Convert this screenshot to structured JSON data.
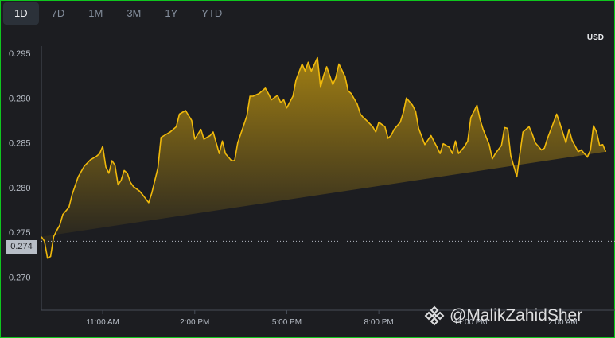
{
  "tabs": [
    {
      "label": "1D",
      "active": true
    },
    {
      "label": "7D",
      "active": false
    },
    {
      "label": "1M",
      "active": false
    },
    {
      "label": "3M",
      "active": false
    },
    {
      "label": "1Y",
      "active": false
    },
    {
      "label": "YTD",
      "active": false
    }
  ],
  "currency": "USD",
  "watermark": "@MalikZahidSher",
  "colors": {
    "background": "#1c1d21",
    "line": "#f0b90b",
    "frame": "#0fc61e",
    "active_tab": "#2b3139"
  },
  "chart_data": {
    "type": "area",
    "ylim": [
      0.2663,
      0.2958
    ],
    "yticks": [
      {
        "value": 0.295,
        "label": "0.295"
      },
      {
        "value": 0.29,
        "label": "0.290"
      },
      {
        "value": 0.285,
        "label": "0.285"
      },
      {
        "value": 0.28,
        "label": "0.280"
      },
      {
        "value": 0.275,
        "label": "0.275"
      },
      {
        "value": 0.27,
        "label": "0.270"
      }
    ],
    "xlim": [
      9.0,
      27.7
    ],
    "xticks": [
      {
        "value": 11,
        "label": "11:00 AM"
      },
      {
        "value": 14,
        "label": "2:00 PM"
      },
      {
        "value": 17,
        "label": "5:00 PM"
      },
      {
        "value": 20,
        "label": "8:00 PM"
      },
      {
        "value": 23,
        "label": "11:00 PM"
      },
      {
        "value": 26,
        "label": "2:00 AM"
      }
    ],
    "current_price": {
      "value": 0.274,
      "label": "0.274"
    },
    "x": [
      9.0,
      9.1,
      9.2,
      9.3,
      9.4,
      9.5,
      9.6,
      9.7,
      9.9,
      10.0,
      10.2,
      10.3,
      10.4,
      10.6,
      10.8,
      10.9,
      11.0,
      11.1,
      11.2,
      11.3,
      11.4,
      11.5,
      11.6,
      11.7,
      11.8,
      11.9,
      12.0,
      12.2,
      12.3,
      12.5,
      12.6,
      12.8,
      12.9,
      13.0,
      13.2,
      13.4,
      13.5,
      13.7,
      13.9,
      14.0,
      14.2,
      14.3,
      14.5,
      14.6,
      14.8,
      14.9,
      15.0,
      15.2,
      15.3,
      15.4,
      15.6,
      15.7,
      15.8,
      15.9,
      16.1,
      16.3,
      16.4,
      16.5,
      16.7,
      16.8,
      16.9,
      17.0,
      17.2,
      17.3,
      17.5,
      17.6,
      17.7,
      17.8,
      18.0,
      18.1,
      18.2,
      18.3,
      18.5,
      18.6,
      18.7,
      18.9,
      19.0,
      19.1,
      19.3,
      19.4,
      19.5,
      19.6,
      19.8,
      19.9,
      20.0,
      20.2,
      20.3,
      20.4,
      20.5,
      20.7,
      20.8,
      20.9,
      21.1,
      21.2,
      21.3,
      21.5,
      21.6,
      21.7,
      21.9,
      22.0,
      22.1,
      22.3,
      22.4,
      22.5,
      22.6,
      22.8,
      22.9,
      23.0,
      23.2,
      23.3,
      23.4,
      23.6,
      23.7,
      23.8,
      24.0,
      24.1,
      24.2,
      24.3,
      24.5,
      24.6,
      24.7,
      24.9,
      25.0,
      25.1,
      25.3,
      25.4,
      25.5,
      25.7,
      25.8,
      25.9,
      26.1,
      26.2,
      26.3,
      26.5,
      26.6,
      26.8,
      26.9,
      27.0,
      27.1,
      27.2,
      27.3,
      27.4,
      27.5,
      27.6
    ],
    "values": [
      0.2745,
      0.274,
      0.2721,
      0.2723,
      0.2745,
      0.2752,
      0.2758,
      0.277,
      0.2778,
      0.2792,
      0.2812,
      0.2818,
      0.2824,
      0.2831,
      0.2835,
      0.2838,
      0.2846,
      0.2823,
      0.2816,
      0.283,
      0.2825,
      0.2803,
      0.2808,
      0.2819,
      0.2816,
      0.2806,
      0.2801,
      0.2796,
      0.2792,
      0.2783,
      0.2794,
      0.2822,
      0.2856,
      0.2858,
      0.2862,
      0.2868,
      0.2882,
      0.2886,
      0.2875,
      0.2854,
      0.2865,
      0.2854,
      0.2858,
      0.2862,
      0.2838,
      0.2852,
      0.2838,
      0.283,
      0.283,
      0.285,
      0.287,
      0.288,
      0.2902,
      0.2902,
      0.2905,
      0.2911,
      0.2905,
      0.2898,
      0.2903,
      0.2895,
      0.2898,
      0.2889,
      0.2902,
      0.292,
      0.2938,
      0.293,
      0.294,
      0.293,
      0.2945,
      0.2912,
      0.2925,
      0.2935,
      0.2915,
      0.2923,
      0.2938,
      0.2924,
      0.2908,
      0.2905,
      0.2893,
      0.2882,
      0.2878,
      0.2875,
      0.2868,
      0.2862,
      0.2873,
      0.2868,
      0.2855,
      0.2858,
      0.2865,
      0.2873,
      0.2884,
      0.29,
      0.2892,
      0.2885,
      0.2866,
      0.2848,
      0.2853,
      0.2858,
      0.2845,
      0.2838,
      0.2849,
      0.2845,
      0.2838,
      0.2852,
      0.2838,
      0.2846,
      0.2852,
      0.2878,
      0.2892,
      0.2876,
      0.2865,
      0.2848,
      0.2832,
      0.2838,
      0.2847,
      0.2867,
      0.2866,
      0.2836,
      0.2812,
      0.2838,
      0.2862,
      0.2868,
      0.286,
      0.285,
      0.2842,
      0.2844,
      0.2855,
      0.2873,
      0.2882,
      0.2872,
      0.285,
      0.2865,
      0.2853,
      0.284,
      0.2842,
      0.2834,
      0.2842,
      0.2869,
      0.2862,
      0.2847,
      0.2848,
      0.284
    ]
  }
}
